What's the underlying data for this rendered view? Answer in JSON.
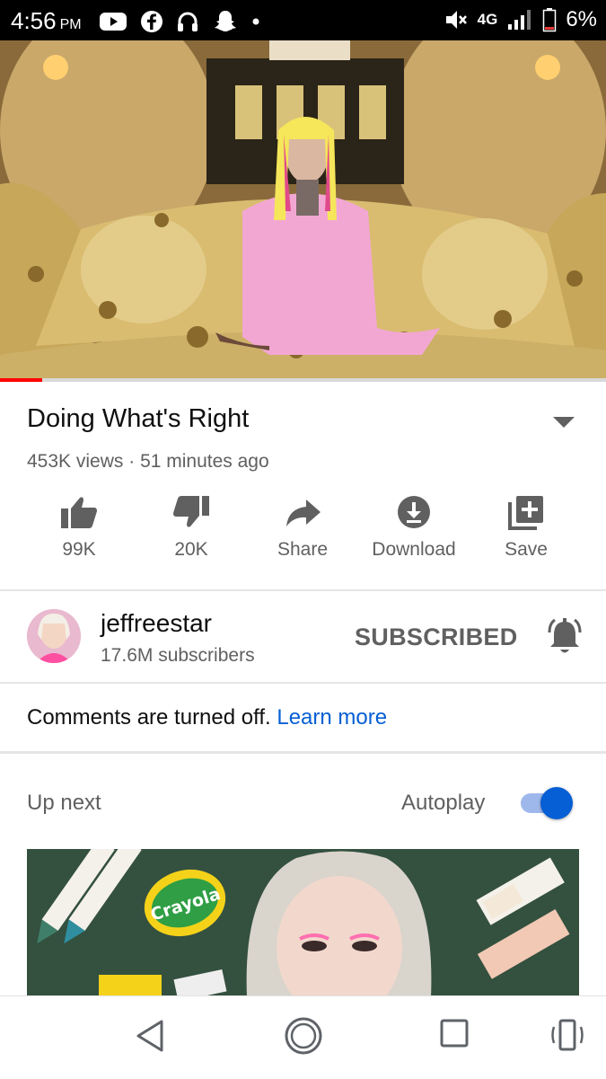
{
  "status_bar": {
    "time": "4:56",
    "ampm": "PM",
    "network": "4G",
    "battery": "6%",
    "icons": [
      "youtube-icon",
      "facebook-icon",
      "headphones-icon",
      "snapchat-icon",
      "dot-icon",
      "mute-icon",
      "network-icon",
      "signal-icon",
      "battery-icon"
    ]
  },
  "video": {
    "title": "Doing What's Right",
    "views": "453K views",
    "separator": " · ",
    "age": "51 minutes ago",
    "progress": 0.07
  },
  "actions": [
    {
      "icon": "thumbs-up-icon",
      "label": "99K"
    },
    {
      "icon": "thumbs-down-icon",
      "label": "20K"
    },
    {
      "icon": "share-icon",
      "label": "Share"
    },
    {
      "icon": "download-icon",
      "label": "Download"
    },
    {
      "icon": "save-playlist-icon",
      "label": "Save"
    }
  ],
  "channel": {
    "name": "jeffreestar",
    "subscribers": "17.6M subscribers",
    "subscribe_state": "SUBSCRIBED"
  },
  "comments": {
    "text": "Comments are turned off.",
    "link": "Learn more"
  },
  "up_next": {
    "label": "Up next",
    "autoplay_label": "Autoplay",
    "autoplay_on": true
  },
  "thumbnail": {
    "brand_text": "Crayola"
  },
  "colors": {
    "accent": "#065fd4",
    "progress": "#ff0000",
    "secondary_text": "#606060"
  }
}
